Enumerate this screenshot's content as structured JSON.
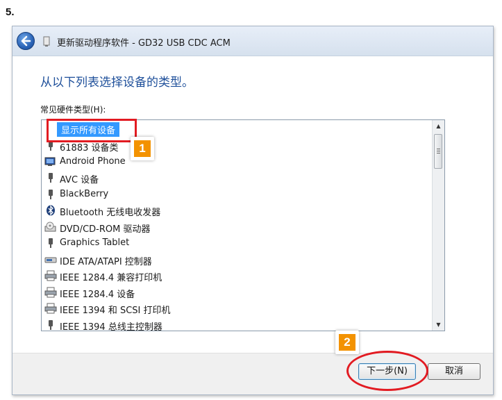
{
  "step_label": "5.",
  "window": {
    "title": "更新驱动程序软件 - GD32 USB CDC ACM"
  },
  "heading": "从以下列表选择设备的类型。",
  "list_label": "常见硬件类型(H):",
  "list_items": [
    {
      "label": "显示所有设备",
      "icon": "none",
      "selected": true
    },
    {
      "label": "61883 设备类",
      "icon": "usb-plug-icon"
    },
    {
      "label": "Android Phone",
      "icon": "monitor-icon"
    },
    {
      "label": "AVC 设备",
      "icon": "usb-plug-icon"
    },
    {
      "label": "BlackBerry",
      "icon": "usb-plug-icon"
    },
    {
      "label": "Bluetooth 无线电收发器",
      "icon": "bluetooth-icon"
    },
    {
      "label": "DVD/CD-ROM 驱动器",
      "icon": "optical-drive-icon"
    },
    {
      "label": "Graphics Tablet",
      "icon": "usb-plug-icon"
    },
    {
      "label": "IDE ATA/ATAPI 控制器",
      "icon": "disk-controller-icon"
    },
    {
      "label": "IEEE 1284.4 兼容打印机",
      "icon": "printer-icon"
    },
    {
      "label": "IEEE 1284.4 设备",
      "icon": "printer-icon"
    },
    {
      "label": "IEEE 1394 和 SCSI 打印机",
      "icon": "printer-icon"
    },
    {
      "label": "IEEE 1394 总线主控制器",
      "icon": "usb-plug-icon"
    }
  ],
  "annotations": {
    "badge_1": "1",
    "badge_2": "2"
  },
  "buttons": {
    "next": "下一步(N)",
    "cancel": "取消"
  },
  "colors": {
    "selection": "#3399ff",
    "heading": "#1e4f9a",
    "annotation_red": "#e21b22",
    "badge_orange": "#f39200"
  }
}
